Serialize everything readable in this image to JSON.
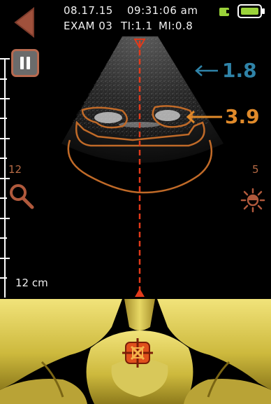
{
  "header": {
    "date": "08.17.15",
    "time": "09:31:06 am",
    "exam": "EXAM 03",
    "ti": "TI:1.1",
    "mi": "MI:0.8"
  },
  "controls": {
    "back": "back-button",
    "pause": "pause-button",
    "zoom_value": "12",
    "brightness_value": "5"
  },
  "scan": {
    "depth_label": "12 cm",
    "measure_blue": "1.8",
    "measure_orange": "3.9"
  },
  "colors": {
    "orange": "#e08a2a",
    "blue": "#2f83a8",
    "red_line": "#e23a1a",
    "battery_green": "#9bd33a"
  }
}
